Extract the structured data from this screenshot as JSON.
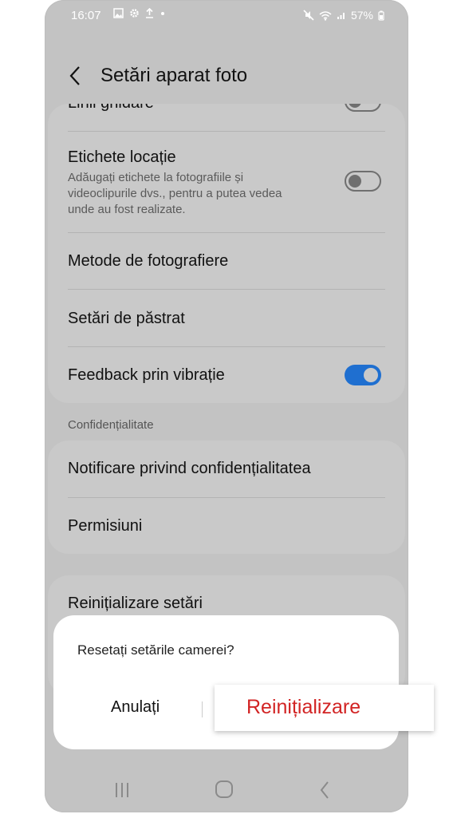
{
  "status": {
    "time": "16:07",
    "battery": "57%"
  },
  "header": {
    "title": "Setări aparat foto"
  },
  "settings": {
    "partial_item_label": "Linii ghidare",
    "location_tags": {
      "label": "Etichete locație",
      "description": "Adăugați etichete la fotografiile și videoclipurile dvs., pentru a putea vedea unde au fost realizate.",
      "enabled": false
    },
    "shooting_methods": {
      "label": "Metode de fotografiere"
    },
    "settings_to_keep": {
      "label": "Setări de păstrat"
    },
    "vibration_feedback": {
      "label": "Feedback prin vibrație",
      "enabled": true
    }
  },
  "privacy": {
    "header": "Confidențialitate",
    "notice": {
      "label": "Notificare privind confidențialitatea"
    },
    "permissions": {
      "label": "Permisiuni"
    }
  },
  "reset": {
    "label": "Reinițializare setări"
  },
  "dialog": {
    "message": "Resetați setările camerei?",
    "cancel": "Anulați",
    "confirm": "Reinițializare"
  },
  "colors": {
    "accent": "#1f6fd0",
    "danger": "#d22424",
    "overlay": "#c3c3c3"
  },
  "icons": [
    "image-icon",
    "gear-icon",
    "upload-icon",
    "mute-icon",
    "wifi-icon",
    "signal-icon",
    "battery-icon",
    "back-icon",
    "recent-apps-icon",
    "home-icon",
    "nav-back-icon"
  ]
}
